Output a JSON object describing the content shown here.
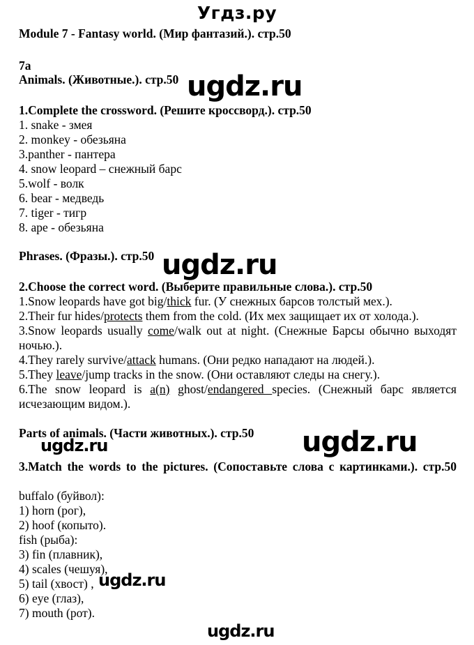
{
  "site_title": "Угдз.ру",
  "watermark": "ugdz.ru",
  "module_title": "Module 7 - Fantasy world. (Мир фантазий.). стр.50",
  "unit": "7a",
  "section1": {
    "heading": "Animals. (Животные.). стр.50",
    "task": "1.Complete the crossword. (Решите кроссворд.). стр.50",
    "items": [
      "1. snake - змея",
      "2. monkey - обезьяна",
      "3.panther - пантера",
      "4. snow leopard – снежный барс",
      "5.wolf - волк",
      "6. bear - медведь",
      "7. tiger - тигр",
      "8. ape - обезьяна"
    ]
  },
  "section2": {
    "heading": "Phrases. (Фразы.). стр.50",
    "task": "2.Choose the correct word. (Выберите правильные слова.). стр.50",
    "items": [
      {
        "pre": "1.Snow leopards have got big/",
        "answer": "thick",
        "post": " fur. (У снежных барсов толстый мех.)."
      },
      {
        "pre": "2.Their fur hides/",
        "answer": "protects",
        "post": " them from the cold. (Их мех защищает их от холода.)."
      },
      {
        "pre": "3.Snow leopards usually ",
        "answer": "come",
        "post": "/walk out at night. (Снежные Барсы обычно выходят ночью.)."
      },
      {
        "pre": "4.They rarely survive/",
        "answer": "attack",
        "post": " humans. (Они редко нападают на людей.)."
      },
      {
        "pre": "5.They ",
        "answer": "leave",
        "post": "/jump tracks in the snow. (Они оставляют следы на снегу.)."
      },
      {
        "pre": "6.The snow leopard is ",
        "answer": "a(n)",
        "mid": " ghost/",
        "answer2": "endangered ",
        "post": "species. (Снежный барс является исчезающим видом.)."
      }
    ]
  },
  "section3": {
    "heading": "Parts of animals. (Части животных.). стр.50",
    "task": "3.Match the words to the pictures. (Сопоставьте слова с картинками.). стр.50",
    "groups": [
      {
        "label": "buffalo (буйвол):",
        "items": [
          "1) horn (рог),",
          "2) hoof (копыто)."
        ]
      },
      {
        "label": "fish (рыба):",
        "items": [
          "3) fin (плавник),",
          "4) scales (чешуя),",
          "5) tail (хвост) ,",
          "6) eye (глаз),",
          "7) mouth (рот)."
        ]
      }
    ]
  }
}
